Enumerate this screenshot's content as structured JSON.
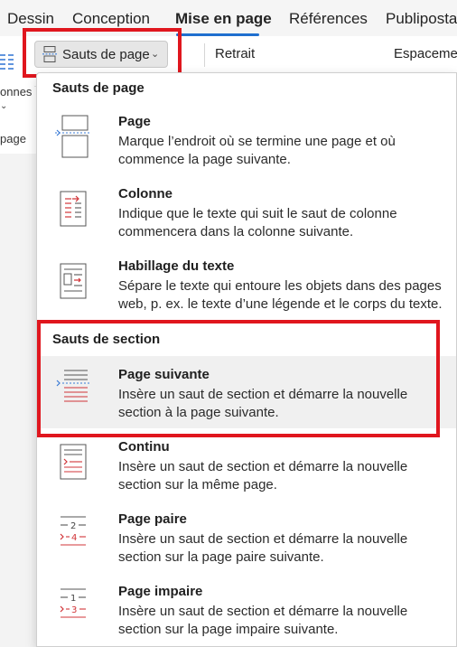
{
  "tabs": [
    {
      "label": "Dessin"
    },
    {
      "label": "Conception"
    },
    {
      "label": "Mise en page"
    },
    {
      "label": "Références"
    },
    {
      "label": "Publiposta"
    }
  ],
  "ribbon": {
    "columns_label_fragment": "onnes",
    "page_label_fragment": "page",
    "breaks_button": "Sauts de page",
    "indent_label": "Retrait",
    "spacing_label": "Espacemen"
  },
  "menu": {
    "page_breaks_heading": "Sauts de page",
    "section_breaks_heading": "Sauts de section",
    "page_breaks": [
      {
        "title": "Page",
        "icon": "page-break-icon",
        "description": "Marque l’endroit où se termine une page et où commence la page suivante."
      },
      {
        "title": "Colonne",
        "icon": "column-break-icon",
        "description": "Indique que le texte qui suit le saut de colonne commencera dans la colonne suivante."
      },
      {
        "title": "Habillage du texte",
        "icon": "text-wrapping-icon",
        "description": "Sépare le texte qui entoure les objets dans des pages web, p. ex. le texte d’une légende et le corps du texte."
      }
    ],
    "section_breaks": [
      {
        "title": "Page suivante",
        "icon": "next-page-icon",
        "description": "Insère un saut de section et démarre la nouvelle section à la page suivante."
      },
      {
        "title": "Continu",
        "icon": "continuous-icon",
        "description": "Insère un saut de section et démarre la nouvelle section sur la même page."
      },
      {
        "title": "Page paire",
        "icon": "even-page-icon",
        "description": "Insère un saut de section et démarre la nouvelle section sur la page paire suivante."
      },
      {
        "title": "Page impaire",
        "icon": "odd-page-icon",
        "description": "Insère un saut de section et démarre la nouvelle section sur la page impaire suivante."
      }
    ]
  },
  "colors": {
    "accent": "#1f6fcf",
    "highlight": "#e0161e",
    "icon_red": "#d13438"
  }
}
